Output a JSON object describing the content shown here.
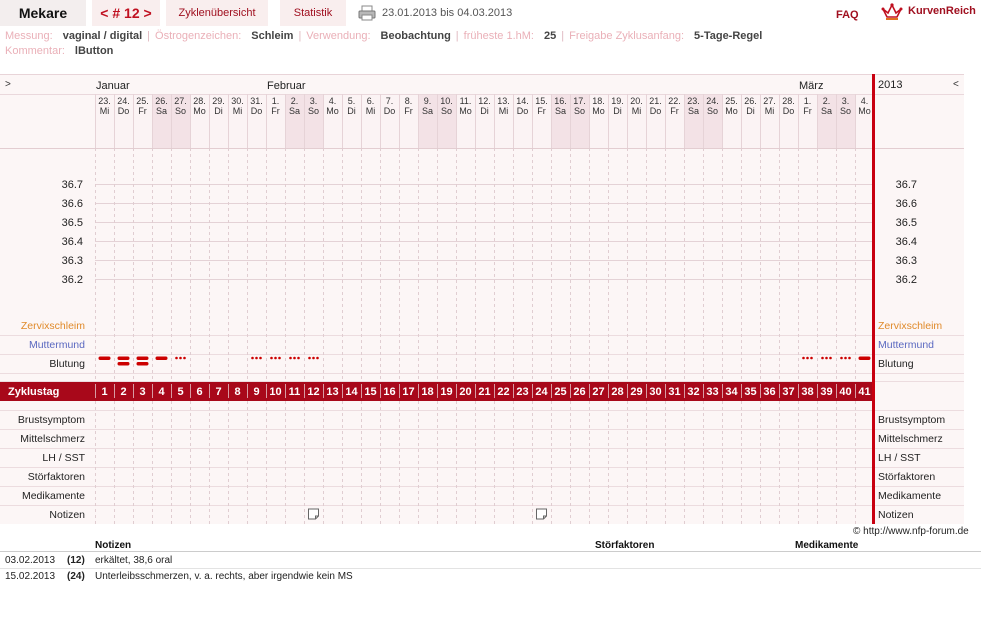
{
  "header": {
    "user": "Mekare",
    "cycle_nav": "< # 12 >",
    "tab_overview": "Zyklenübersicht",
    "tab_statistics": "Statistik",
    "date_range": "23.01.2013 bis 04.03.2013",
    "faq": "FAQ",
    "brand": "KurvenReich"
  },
  "meta": {
    "line1": [
      {
        "label": "Messung:",
        "value": "vaginal / digital"
      },
      {
        "label": "Östrogenzeichen:",
        "value": "Schleim"
      },
      {
        "label": "Verwendung:",
        "value": "Beobachtung"
      },
      {
        "label": "früheste 1.hM:",
        "value": "25"
      },
      {
        "label": "Freigabe Zyklusanfang:",
        "value": "5-Tage-Regel"
      }
    ],
    "line2": [
      {
        "label": "Kommentar:",
        "value": "lButton"
      }
    ]
  },
  "chart_data": {
    "type": "table",
    "nav_left": ">",
    "nav_right": "<",
    "year": "2013",
    "months": [
      {
        "name": "Januar",
        "start_index": 0
      },
      {
        "name": "Februar",
        "start_index": 9
      },
      {
        "name": "März",
        "start_index": 37
      }
    ],
    "days": [
      {
        "d": "23.",
        "w": "Mi"
      },
      {
        "d": "24.",
        "w": "Do"
      },
      {
        "d": "25.",
        "w": "Fr"
      },
      {
        "d": "26.",
        "w": "Sa"
      },
      {
        "d": "27.",
        "w": "So"
      },
      {
        "d": "28.",
        "w": "Mo"
      },
      {
        "d": "29.",
        "w": "Di"
      },
      {
        "d": "30.",
        "w": "Mi"
      },
      {
        "d": "31.",
        "w": "Do"
      },
      {
        "d": "1.",
        "w": "Fr"
      },
      {
        "d": "2.",
        "w": "Sa"
      },
      {
        "d": "3.",
        "w": "So"
      },
      {
        "d": "4.",
        "w": "Mo"
      },
      {
        "d": "5.",
        "w": "Di"
      },
      {
        "d": "6.",
        "w": "Mi"
      },
      {
        "d": "7.",
        "w": "Do"
      },
      {
        "d": "8.",
        "w": "Fr"
      },
      {
        "d": "9.",
        "w": "Sa"
      },
      {
        "d": "10.",
        "w": "So"
      },
      {
        "d": "11.",
        "w": "Mo"
      },
      {
        "d": "12.",
        "w": "Di"
      },
      {
        "d": "13.",
        "w": "Mi"
      },
      {
        "d": "14.",
        "w": "Do"
      },
      {
        "d": "15.",
        "w": "Fr"
      },
      {
        "d": "16.",
        "w": "Sa"
      },
      {
        "d": "17.",
        "w": "So"
      },
      {
        "d": "18.",
        "w": "Mo"
      },
      {
        "d": "19.",
        "w": "Di"
      },
      {
        "d": "20.",
        "w": "Mi"
      },
      {
        "d": "21.",
        "w": "Do"
      },
      {
        "d": "22.",
        "w": "Fr"
      },
      {
        "d": "23.",
        "w": "Sa"
      },
      {
        "d": "24.",
        "w": "So"
      },
      {
        "d": "25.",
        "w": "Mo"
      },
      {
        "d": "26.",
        "w": "Di"
      },
      {
        "d": "27.",
        "w": "Mi"
      },
      {
        "d": "28.",
        "w": "Do"
      },
      {
        "d": "1.",
        "w": "Fr"
      },
      {
        "d": "2.",
        "w": "Sa"
      },
      {
        "d": "3.",
        "w": "So"
      },
      {
        "d": "4.",
        "w": "Mo"
      }
    ],
    "temperature_axis": [
      "36.7",
      "36.6",
      "36.5",
      "36.4",
      "36.3",
      "36.2"
    ],
    "temperature_values": [],
    "row_labels": {
      "cervix": "Zervixschleim",
      "cervix_pos": "Muttermund",
      "bleeding": "Blutung",
      "cycle_day": "Zyklustag",
      "breast": "Brustsymptom",
      "mittel": "Mittelschmerz",
      "lh": "LH / SST",
      "stoer": "Störfaktoren",
      "med": "Medikamente",
      "notes": "Notizen"
    },
    "bleeding": [
      {
        "day": 1,
        "level": "medium"
      },
      {
        "day": 2,
        "level": "heavy"
      },
      {
        "day": 3,
        "level": "heavy"
      },
      {
        "day": 4,
        "level": "medium"
      },
      {
        "day": 5,
        "level": "spotting"
      },
      {
        "day": 9,
        "level": "spotting"
      },
      {
        "day": 10,
        "level": "spotting"
      },
      {
        "day": 11,
        "level": "spotting"
      },
      {
        "day": 12,
        "level": "spotting"
      },
      {
        "day": 38,
        "level": "spotting"
      },
      {
        "day": 39,
        "level": "spotting"
      },
      {
        "day": 40,
        "level": "spotting"
      },
      {
        "day": 41,
        "level": "medium"
      }
    ],
    "note_days": [
      12,
      24
    ],
    "colors": {
      "accent": "#a8081a",
      "weekend": "#f3e2e6",
      "cervix_label": "#e08a2a",
      "cervix_pos_label": "#5a68c0",
      "bleeding": "#cc0000"
    }
  },
  "copyright": "© http://www.nfp-forum.de",
  "notes_table": {
    "col_notes": "Notizen",
    "col_stoer": "Störfaktoren",
    "col_med": "Medikamente",
    "rows": [
      {
        "date": "03.02.2013",
        "cycle": "(12)",
        "text": "erkältet, 38,6 oral"
      },
      {
        "date": "15.02.2013",
        "cycle": "(24)",
        "text": "Unterleibsschmerzen, v. a. rechts, aber irgendwie kein MS"
      }
    ]
  }
}
